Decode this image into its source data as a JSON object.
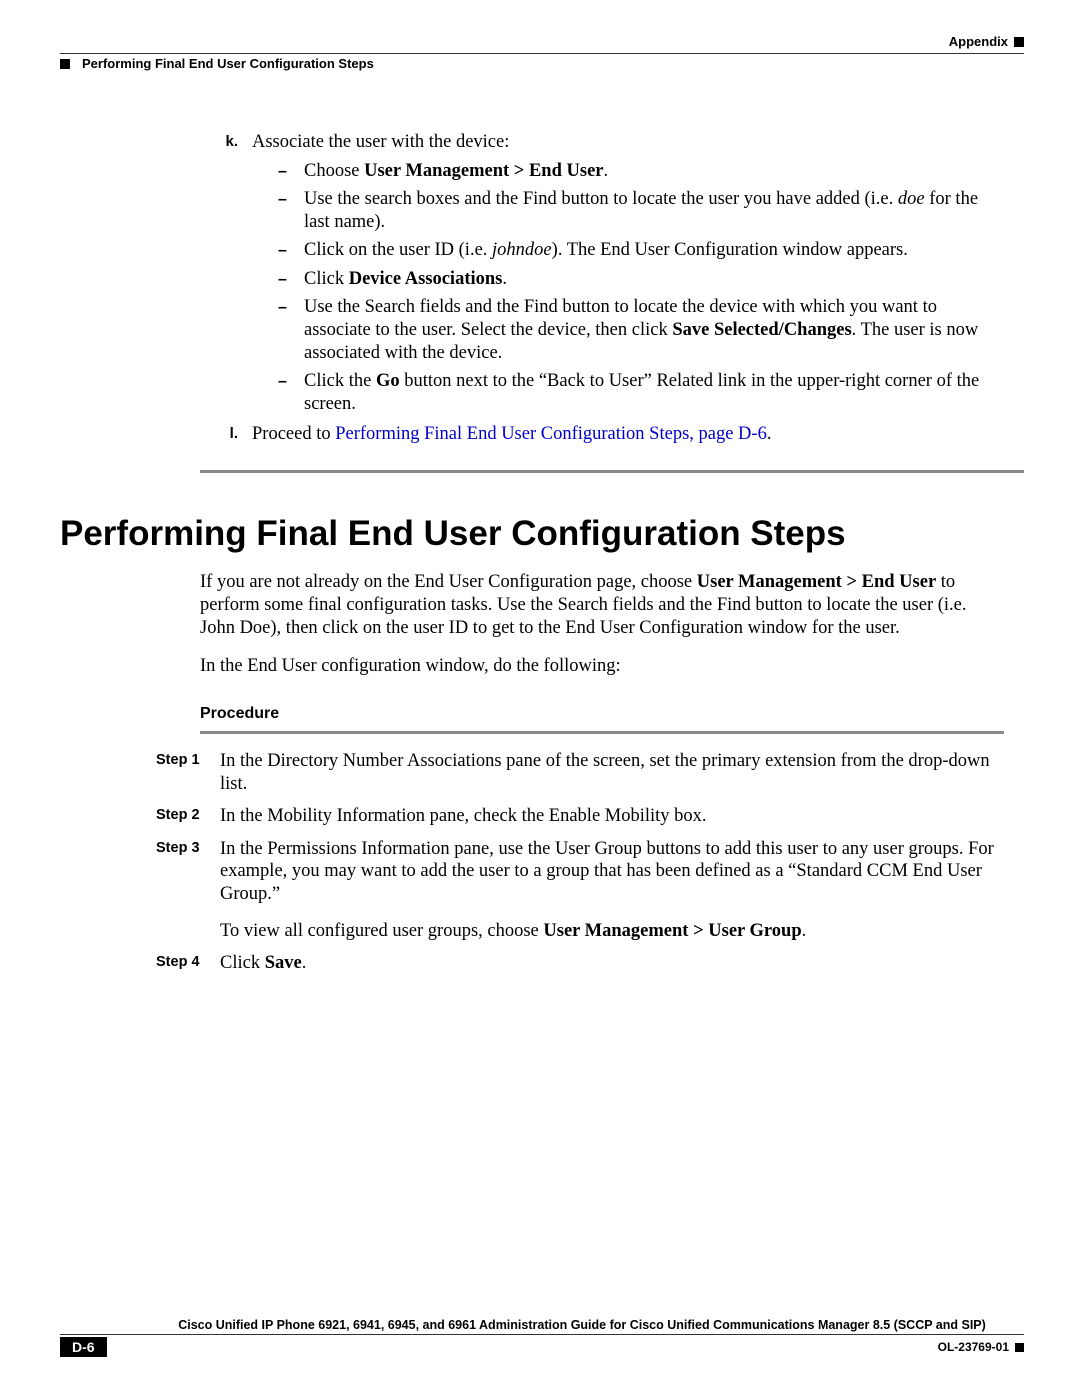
{
  "header": {
    "appendix": "Appendix",
    "section": "Performing Final End User Configuration Steps"
  },
  "upper": {
    "k": {
      "label": "k.",
      "intro": "Associate the user with the device:",
      "b1_pre": "Choose ",
      "b1_bold": "User Management > End User",
      "b1_post": ".",
      "b2_pre": "Use the search boxes and the Find button to locate the user you have added (i.e. ",
      "b2_em": "doe",
      "b2_post": " for the last name).",
      "b3_pre": "Click on the user ID (i.e. ",
      "b3_em": "johndoe",
      "b3_post": "). The End User Configuration window appears.",
      "b4_pre": "Click ",
      "b4_bold": "Device Associations",
      "b4_post": ".",
      "b5_pre": "Use the Search fields and the Find button to locate the device with which you want to associate to the user. Select the device, then click ",
      "b5_bold": "Save Selected/Changes",
      "b5_post": ". The user is now associated with the device.",
      "b6_pre": "Click the ",
      "b6_bold": "Go",
      "b6_post": " button next to the “Back to User” Related link in the upper-right corner of the screen."
    },
    "l": {
      "label": "l.",
      "pre": "Proceed to ",
      "link": "Performing Final End User Configuration Steps, page D-6",
      "post": "."
    }
  },
  "section_title": "Performing Final End User Configuration Steps",
  "intro": {
    "p1_pre": "If you are not already on the End User Configuration page, choose ",
    "p1_bold": "User Management > End User",
    "p1_post": " to perform some final configuration tasks. Use the Search fields and the Find button to locate the user (i.e. John Doe), then click on the user ID to get to the End User Configuration window for the user.",
    "p2": "In the End User configuration window, do the following:"
  },
  "procedure_label": "Procedure",
  "steps": {
    "s1": {
      "label": "Step 1",
      "text": "In the Directory Number Associations pane of the screen, set the primary extension from the drop-down list."
    },
    "s2": {
      "label": "Step 2",
      "text": "In the Mobility Information pane, check the Enable Mobility box."
    },
    "s3": {
      "label": "Step 3",
      "text": "In the Permissions Information pane, use the User Group buttons to add this user to any user groups. For example, you may want to add the user to a group that has been defined as a “Standard CCM End User Group.”",
      "extra_pre": "To view all configured user groups, choose ",
      "extra_bold": "User Management > User Group",
      "extra_post": "."
    },
    "s4": {
      "label": "Step 4",
      "pre": "Click ",
      "bold": "Save",
      "post": "."
    }
  },
  "footer": {
    "title": "Cisco Unified IP Phone 6921, 6941, 6945, and 6961 Administration Guide for Cisco Unified Communications Manager 8.5 (SCCP and SIP)",
    "page": "D-6",
    "doc": "OL-23769-01"
  }
}
